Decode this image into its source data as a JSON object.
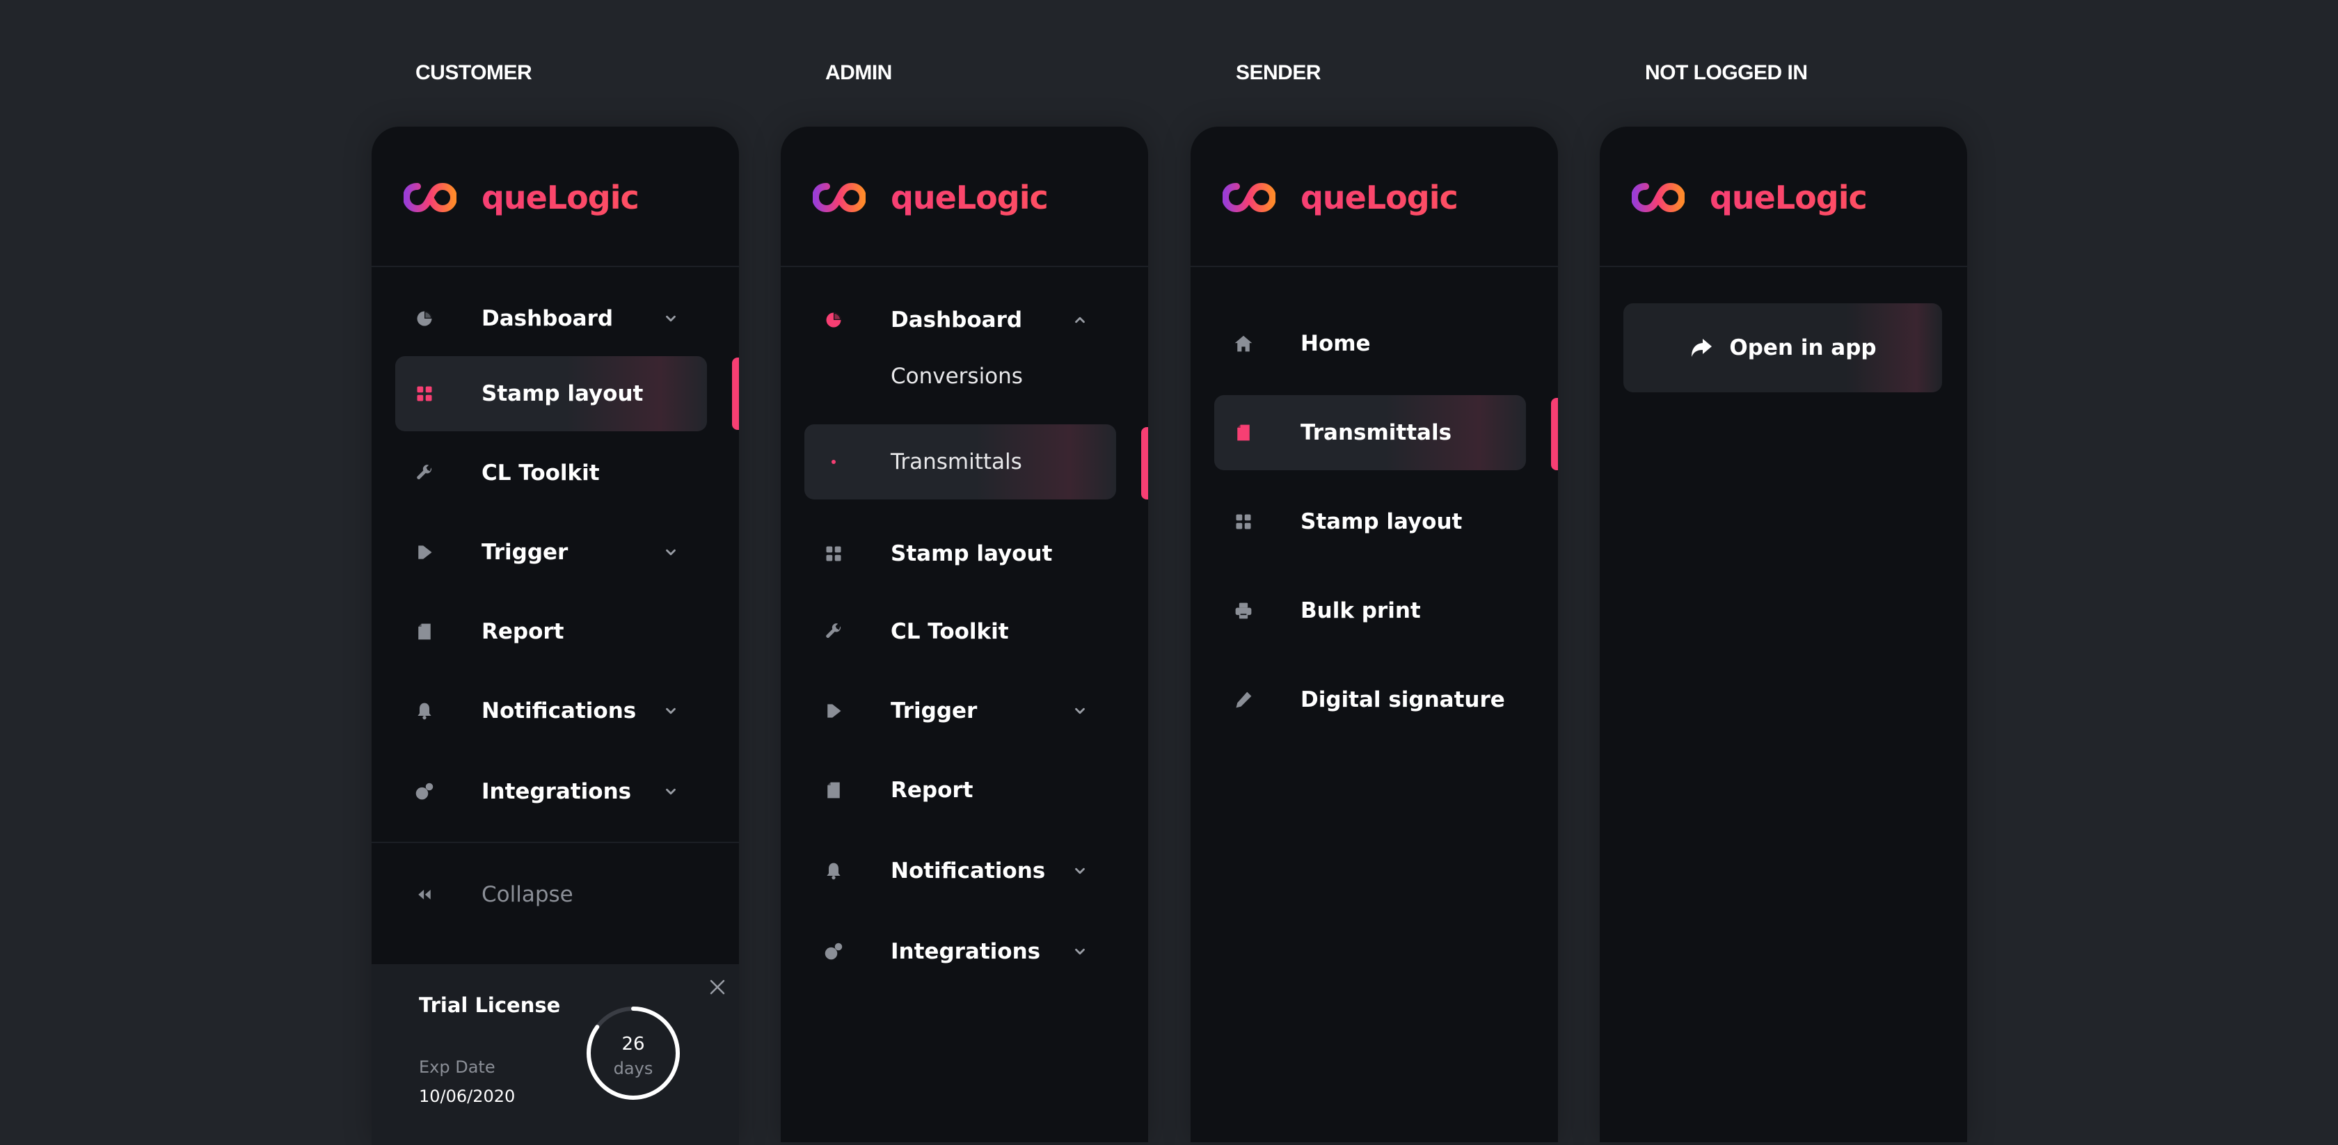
{
  "brand": {
    "name": "queLogic",
    "color": "#f73f73",
    "accent_gradient": [
      "#9b3dd6",
      "#f73f73",
      "#ff8a2b"
    ]
  },
  "columns": {
    "customer": {
      "title": "CUSTOMER",
      "items": [
        {
          "label": "Dashboard",
          "icon": "pie-chart-icon",
          "chevron": "down"
        },
        {
          "label": "Stamp layout",
          "icon": "grid-icon",
          "active": true
        },
        {
          "label": "CL Toolkit",
          "icon": "wrench-icon"
        },
        {
          "label": "Trigger",
          "icon": "play-icon",
          "chevron": "down"
        },
        {
          "label": "Report",
          "icon": "document-icon"
        },
        {
          "label": "Notifications",
          "icon": "bell-icon",
          "chevron": "down"
        },
        {
          "label": "Integrations",
          "icon": "integrations-icon",
          "chevron": "down"
        }
      ],
      "collapse_label": "Collapse",
      "trial": {
        "title": "Trial License",
        "exp_label": "Exp Date",
        "exp_date": "10/06/2020",
        "days_number": "26",
        "days_unit": "days",
        "progress_fraction": 0.85
      }
    },
    "admin": {
      "title": "ADMIN",
      "items": [
        {
          "label": "Dashboard",
          "icon": "pie-chart-icon",
          "chevron": "up",
          "expanded": true
        },
        {
          "label": "Conversions",
          "sub": true
        },
        {
          "label": "Transmittals",
          "sub": true,
          "active": true
        },
        {
          "label": "Stamp layout",
          "icon": "grid-icon"
        },
        {
          "label": "CL Toolkit",
          "icon": "wrench-icon"
        },
        {
          "label": "Trigger",
          "icon": "play-icon",
          "chevron": "down"
        },
        {
          "label": "Report",
          "icon": "document-icon"
        },
        {
          "label": "Notifications",
          "icon": "bell-icon",
          "chevron": "down"
        },
        {
          "label": "Integrations",
          "icon": "integrations-icon",
          "chevron": "down"
        }
      ]
    },
    "sender": {
      "title": "SENDER",
      "items": [
        {
          "label": "Home",
          "icon": "home-icon"
        },
        {
          "label": "Transmittals",
          "icon": "document-icon",
          "active": true
        },
        {
          "label": "Stamp layout",
          "icon": "grid-icon"
        },
        {
          "label": "Bulk print",
          "icon": "printer-icon"
        },
        {
          "label": "Digital signature",
          "icon": "pencil-icon"
        }
      ]
    },
    "not_logged_in": {
      "title": "NOT LOGGED IN",
      "open_in_app": {
        "label": "Open in app",
        "icon": "share-arrow-icon"
      }
    }
  }
}
